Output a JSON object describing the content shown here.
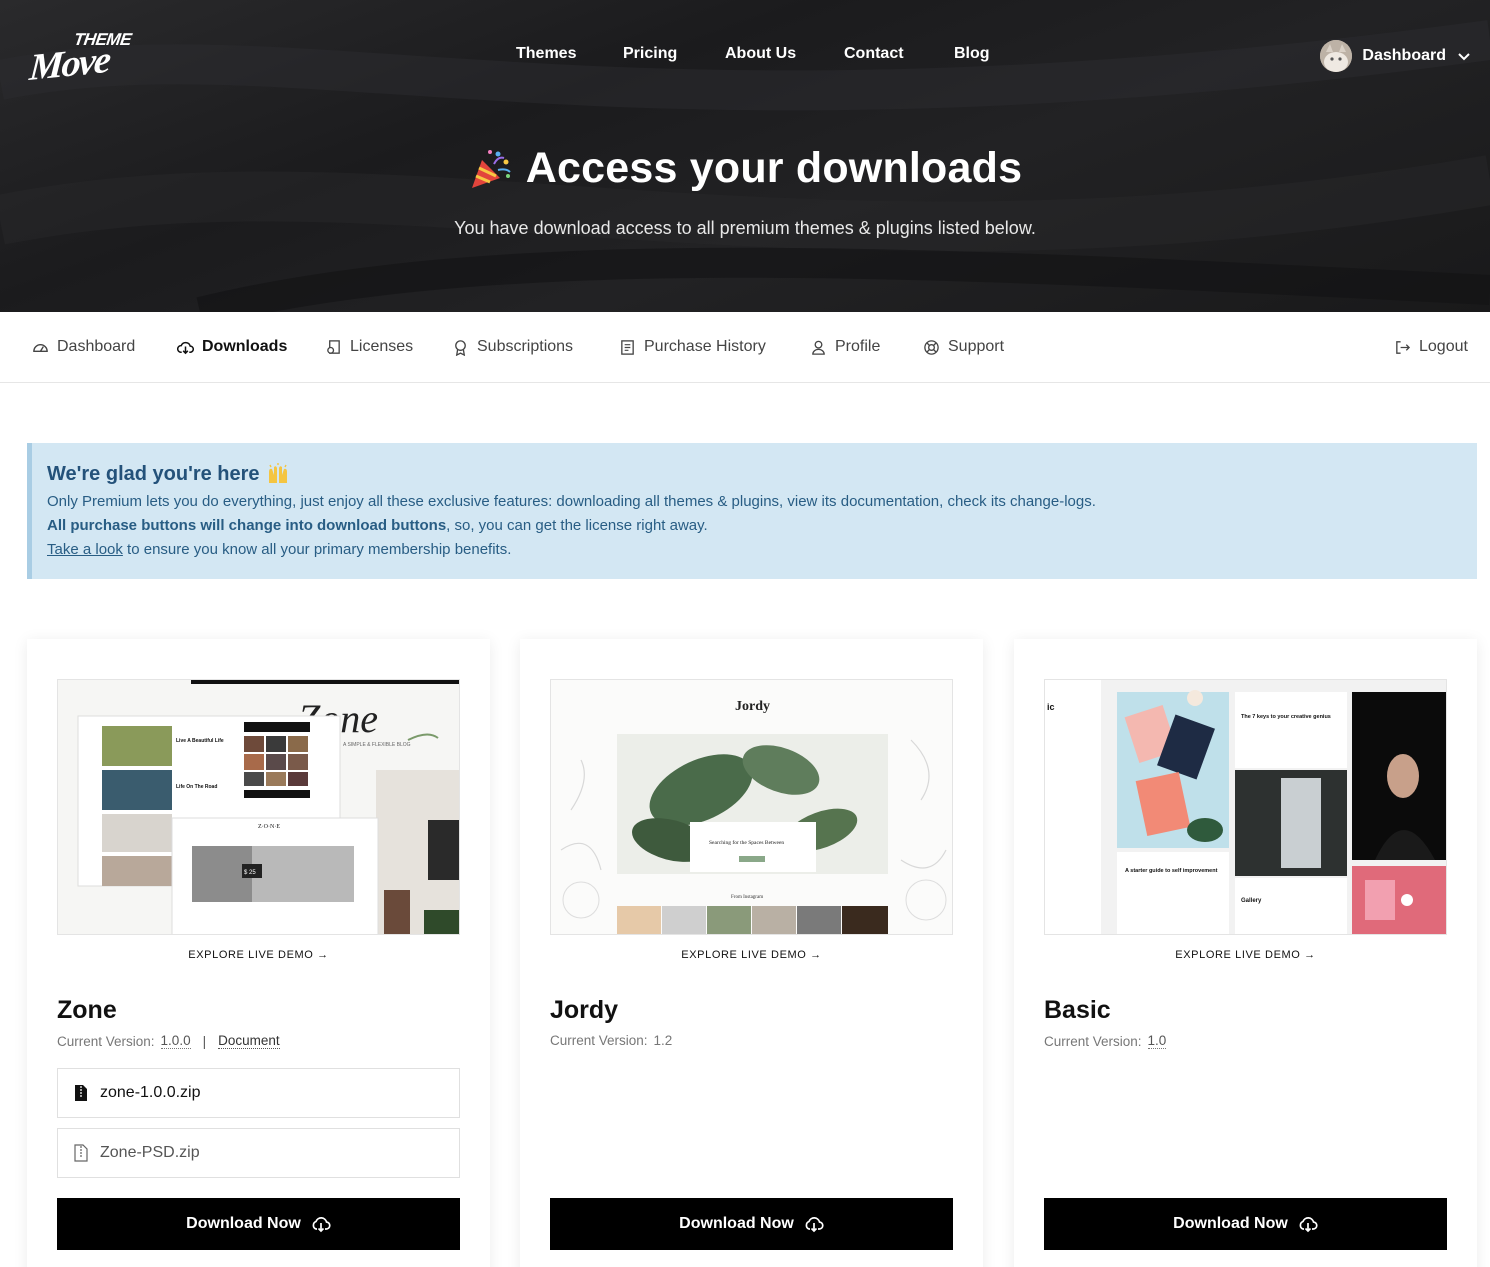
{
  "brand": {
    "logo_top": "THEME",
    "logo_main": "Move"
  },
  "nav": {
    "items": [
      "Themes",
      "Pricing",
      "About Us",
      "Contact",
      "Blog"
    ]
  },
  "user": {
    "label": "Dashboard"
  },
  "hero": {
    "title": "Access your downloads",
    "subtitle": "You have download access to all premium themes & plugins listed below."
  },
  "tabs": {
    "items": [
      "Dashboard",
      "Downloads",
      "Licenses",
      "Subscriptions",
      "Purchase History",
      "Profile",
      "Support"
    ],
    "active": "Downloads",
    "logout": "Logout"
  },
  "notice": {
    "title": "We're glad you're here",
    "line1": "Only Premium lets you do everything, just enjoy all these exclusive features: downloading all themes & plugins, view its documentation, check its change-logs.",
    "line2_bold": "All purchase buttons will change into download buttons",
    "line2_rest": ", so, you can get the license right away.",
    "line3_link": "Take a look",
    "line3_rest": " to ensure you know all your primary membership benefits."
  },
  "cards": [
    {
      "demo": "EXPLORE LIVE DEMO →",
      "title": "Zone",
      "version_label": "Current Version:",
      "version": "1.0.0",
      "separator": "|",
      "doc_label": "Document",
      "files": [
        "zone-1.0.0.zip",
        "Zone-PSD.zip"
      ],
      "button": "Download Now",
      "preview": {
        "script_title": "Zone",
        "tagline": "A SIMPLE & FLEXIBLE BLOG",
        "logo_text": "Z·O·N·E",
        "post1": "Live A Beautiful Life",
        "post2": "Life On The Road",
        "price": "$ 25"
      }
    },
    {
      "demo": "EXPLORE LIVE DEMO →",
      "title": "Jordy",
      "version_label": "Current Version:",
      "version": "1.2",
      "files": [],
      "button": "Download Now",
      "preview": {
        "logo_text": "Jordy",
        "post_title": "Searching for the Spaces Between",
        "insta": "From Instagram"
      }
    },
    {
      "demo": "EXPLORE LIVE DEMO →",
      "title": "Basic",
      "version_label": "Current Version:",
      "version": "1.0",
      "files": [],
      "button": "Download Now",
      "preview": {
        "side_text": "ic",
        "post1": "The 7 keys to your creative genius",
        "post2": "A starter guide to self improvement",
        "post3": "Gallery"
      }
    }
  ],
  "colors": {
    "hero_bg": "#1e1e20",
    "notice_bg": "#d3e7f3",
    "notice_text": "#24527a",
    "button_bg": "#000000"
  }
}
